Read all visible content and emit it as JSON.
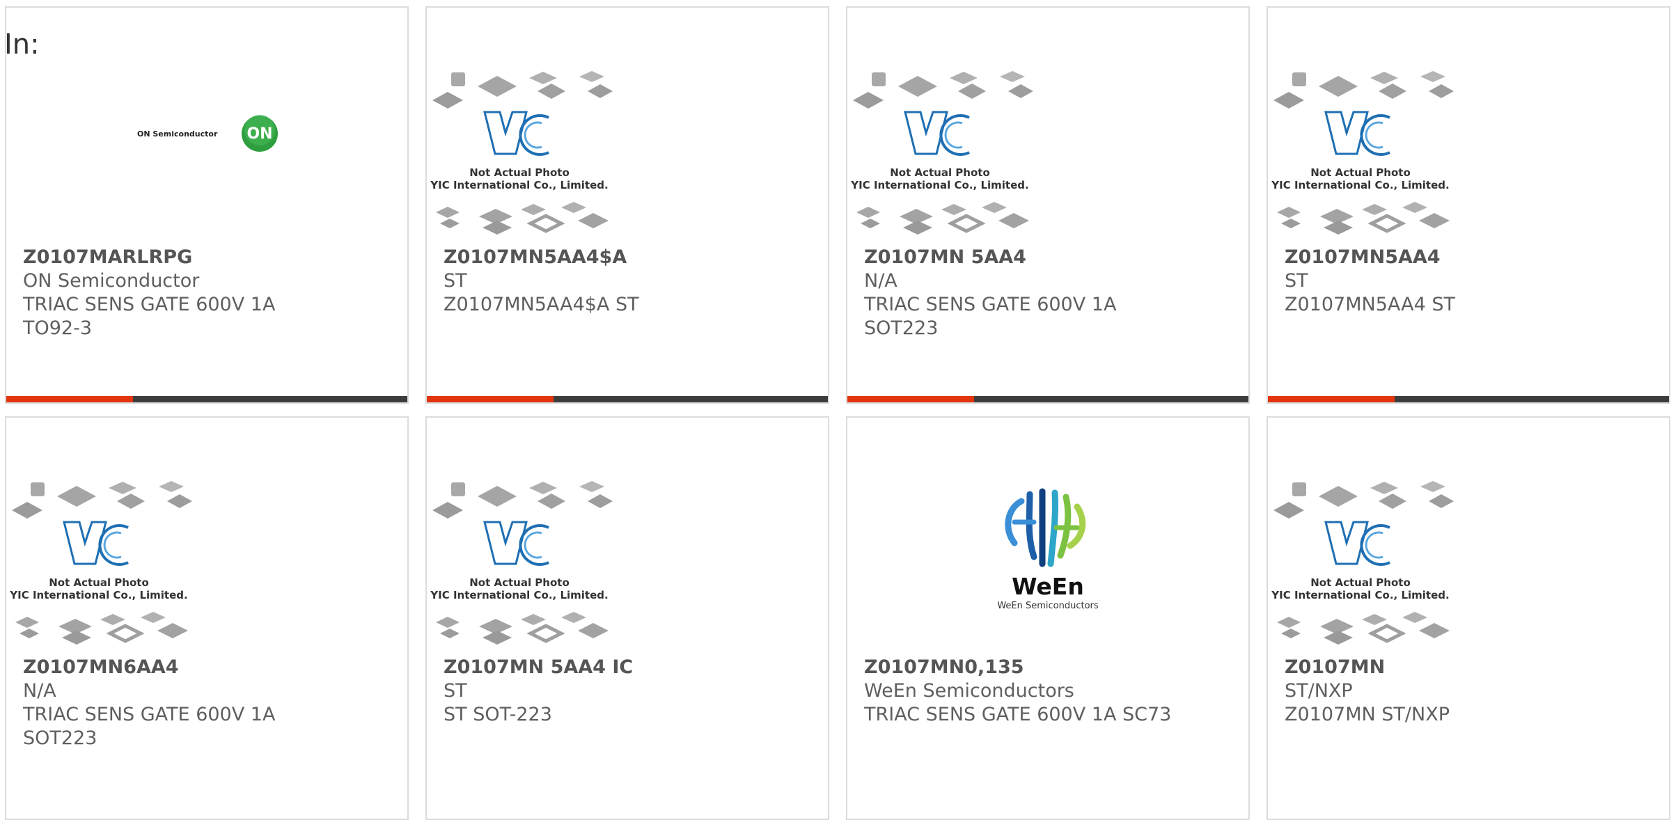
{
  "search": {
    "prefix": "In:"
  },
  "colors": {
    "accent": "#e3350d",
    "bar": "#3d3d3d",
    "border": "#dcdcdc",
    "yic_blue": "#1f6fb3",
    "on_green": "#2e9e3e"
  },
  "placeholder_image": {
    "brand": "YIC",
    "line1": "Not Actual Photo",
    "line2": "YIC International Co., Limited."
  },
  "products": [
    {
      "part_number": "Z0107MARLRPG",
      "manufacturer": "ON Semiconductor",
      "description": "TRIAC SENS GATE 600V 1A",
      "package": "TO92-3",
      "image": "on-semiconductor-logo",
      "logo_text": "ON Semiconductor",
      "logo_mark": "ON"
    },
    {
      "part_number": "Z0107MN5AA4$A",
      "manufacturer": "ST",
      "description": "Z0107MN5AA4$A ST",
      "package": "",
      "image": "yic-placeholder"
    },
    {
      "part_number": "Z0107MN 5AA4",
      "manufacturer": "N/A",
      "description": "TRIAC SENS GATE 600V 1A",
      "package": "SOT223",
      "image": "yic-placeholder"
    },
    {
      "part_number": "Z0107MN5AA4",
      "manufacturer": "ST",
      "description": "Z0107MN5AA4 ST",
      "package": "",
      "image": "yic-placeholder"
    },
    {
      "part_number": "Z0107MN6AA4",
      "manufacturer": "N/A",
      "description": "TRIAC SENS GATE 600V 1A",
      "package": "SOT223",
      "image": "yic-placeholder"
    },
    {
      "part_number": "Z0107MN 5AA4 IC",
      "manufacturer": "ST",
      "description": "ST SOT-223",
      "package": "",
      "image": "yic-placeholder"
    },
    {
      "part_number": "Z0107MN0,135",
      "manufacturer": "WeEn Semiconductors",
      "description": "TRIAC SENS GATE 600V 1A SC73",
      "package": "",
      "image": "ween-logo",
      "logo_text": "WeEn",
      "logo_sub": "WeEn Semiconductors"
    },
    {
      "part_number": "Z0107MN",
      "manufacturer": "ST/NXP",
      "description": "Z0107MN ST/NXP",
      "package": "",
      "image": "yic-placeholder"
    }
  ]
}
